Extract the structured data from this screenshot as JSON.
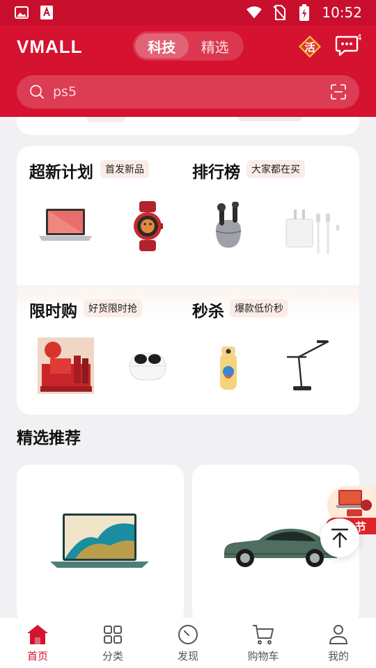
{
  "status_bar": {
    "time": "10:52"
  },
  "header": {
    "logo": "VMALL",
    "tabs": [
      {
        "label": "科技",
        "active": true
      },
      {
        "label": "精选",
        "active": false
      }
    ],
    "badge_label": "活",
    "message_count": "4",
    "search": {
      "placeholder": "ps5"
    }
  },
  "features": {
    "new_plan": {
      "title": "超新计划",
      "tag": "首发新品"
    },
    "ranking": {
      "title": "排行榜",
      "tag": "大家都在买"
    },
    "flash": {
      "title": "限时购",
      "tag": "好货限时抢"
    },
    "seckill": {
      "title": "秒杀",
      "tag": "爆款低价秒"
    }
  },
  "recommend": {
    "heading": "精选推荐"
  },
  "float_promo": {
    "label": "节"
  },
  "bottom_nav": [
    {
      "label": "首页",
      "icon": "home-icon",
      "active": true
    },
    {
      "label": "分类",
      "icon": "grid-icon",
      "active": false
    },
    {
      "label": "发现",
      "icon": "compass-icon",
      "active": false
    },
    {
      "label": "购物车",
      "icon": "cart-icon",
      "active": false
    },
    {
      "label": "我的",
      "icon": "user-icon",
      "active": false
    }
  ],
  "colors": {
    "brand": "#d5122f",
    "status_bar": "#c8102e",
    "tag_bg": "#fbece7"
  }
}
